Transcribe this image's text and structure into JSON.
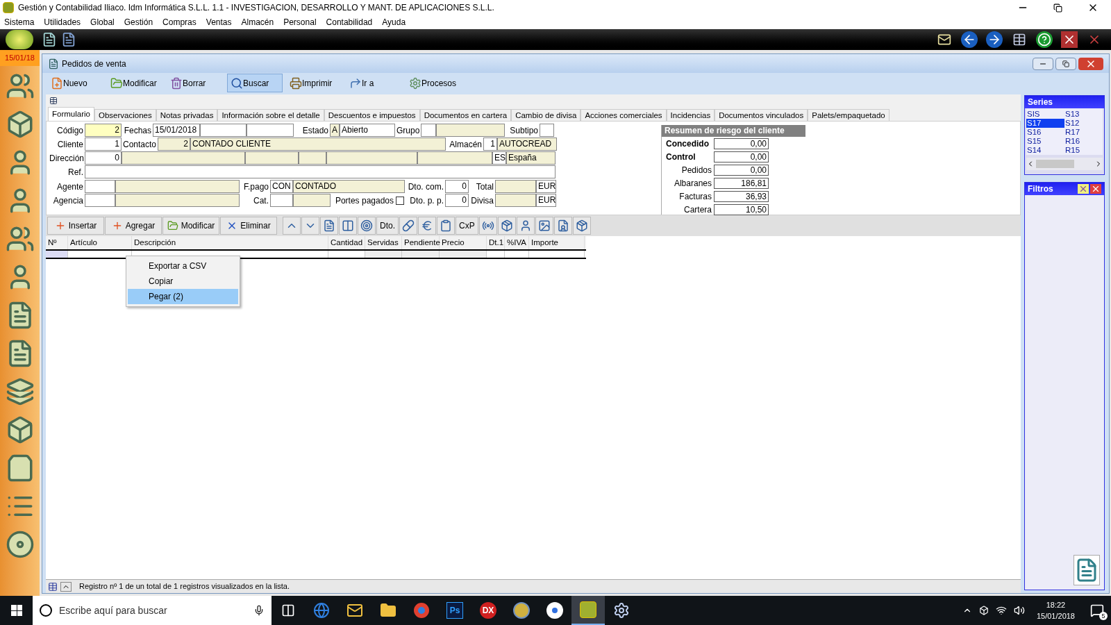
{
  "window": {
    "title": "Gestión y Contabilidad Iliaco. Idm Informática S.L.L. 1.1 - INVESTIGACION, DESARROLLO Y MANT. DE APLICACIONES S.L.L."
  },
  "menu": [
    "Sistema",
    "Utilidades",
    "Global",
    "Gestión",
    "Compras",
    "Ventas",
    "Almacén",
    "Personal",
    "Contabilidad",
    "Ayuda"
  ],
  "sidebar": {
    "date": "15/01/18"
  },
  "document": {
    "title": "Pedidos de venta",
    "toolbar": [
      {
        "label": "Nuevo",
        "selected": false
      },
      {
        "label": "Modificar",
        "selected": false
      },
      {
        "label": "Borrar",
        "selected": false
      },
      {
        "label": "Buscar",
        "selected": true
      },
      {
        "label": "Imprimir",
        "selected": false
      },
      {
        "label": "Ir a",
        "selected": false
      },
      {
        "label": "Procesos",
        "selected": false
      }
    ],
    "tabs": [
      {
        "label": "Formulario",
        "selected": true
      },
      {
        "label": "Observaciones",
        "selected": false
      },
      {
        "label": "Notas privadas",
        "selected": false
      },
      {
        "label": "Información sobre el detalle",
        "selected": false
      },
      {
        "label": "Descuentos e impuestos",
        "selected": false
      },
      {
        "label": "Documentos en cartera",
        "selected": false
      },
      {
        "label": "Cambio de divisa",
        "selected": false
      },
      {
        "label": "Acciones comerciales",
        "selected": false
      },
      {
        "label": "Incidencias",
        "selected": false
      },
      {
        "label": "Documentos vinculados",
        "selected": false
      },
      {
        "label": "Palets/empaquetado",
        "selected": false
      }
    ],
    "form": {
      "codigo": {
        "label": "Código",
        "value": "2"
      },
      "fechas": {
        "label": "Fechas",
        "value": "15/01/2018"
      },
      "estado": {
        "label": "Estado",
        "code": "A",
        "value": "Abierto"
      },
      "grupo": {
        "label": "Grupo"
      },
      "subtipo": {
        "label": "Subtipo"
      },
      "cliente": {
        "label": "Cliente",
        "value": "1"
      },
      "contacto": {
        "label": "Contacto",
        "code": "2",
        "value": "CONTADO CLIENTE"
      },
      "almacen": {
        "label": "Almacén",
        "code": "1",
        "value": "AUTOCREAD"
      },
      "direccion": {
        "label": "Dirección",
        "value": "0",
        "country_code": "ES",
        "country": "España"
      },
      "ref": {
        "label": "Ref."
      },
      "agente": {
        "label": "Agente"
      },
      "agencia": {
        "label": "Agencia"
      },
      "fpago": {
        "label": "F.pago",
        "code": "CON",
        "value": "CONTADO"
      },
      "cat": {
        "label": "Cat."
      },
      "portes": {
        "label": "Portes pagados",
        "checked": false
      },
      "dto_com": {
        "label": "Dto. com.",
        "value": "0"
      },
      "dto_pp": {
        "label": "Dto. p. p.",
        "value": "0"
      },
      "total": {
        "label": "Total",
        "currency": "EUR"
      },
      "divisa": {
        "label": "Divisa",
        "currency": "EUR"
      }
    },
    "risk": {
      "title": "Resumen de riesgo del cliente",
      "rows": [
        {
          "label": "Concedido",
          "value": "0,00",
          "bold": true
        },
        {
          "label": "Control",
          "value": "0,00",
          "bold": true
        },
        {
          "label": "Pedidos",
          "value": "0,00",
          "bold": false
        },
        {
          "label": "Albaranes",
          "value": "186,81",
          "bold": false
        },
        {
          "label": "Facturas",
          "value": "36,93",
          "bold": false
        },
        {
          "label": "Cartera",
          "value": "10,50",
          "bold": false
        }
      ]
    },
    "line_actions": [
      "Insertar",
      "Agregar",
      "Modificar",
      "Eliminar"
    ],
    "text_tools": [
      "Dto.",
      "CxP"
    ],
    "table": {
      "columns": [
        "Nº",
        "Artículo",
        "Descripción",
        "Cantidad",
        "Servidas",
        "Pendiente",
        "Precio",
        "Dt.1",
        "%IVA",
        "Importe"
      ]
    },
    "context_menu": [
      {
        "label": "Exportar a CSV",
        "selected": false
      },
      {
        "label": "Copiar",
        "selected": false
      },
      {
        "label": "Pegar (2)",
        "selected": true
      }
    ],
    "status": "Registro nº 1 de un total de 1 registros visualizados en la lista."
  },
  "series": {
    "title": "Series",
    "items": [
      {
        "label": "SIS",
        "selected": false
      },
      {
        "label": "S17",
        "selected": true
      },
      {
        "label": "S16",
        "selected": false
      },
      {
        "label": "S15",
        "selected": false
      },
      {
        "label": "S14",
        "selected": false
      },
      {
        "label": "S13",
        "selected": false
      },
      {
        "label": "S12",
        "selected": false
      },
      {
        "label": "R17",
        "selected": false
      },
      {
        "label": "R16",
        "selected": false
      },
      {
        "label": "R15",
        "selected": false
      }
    ]
  },
  "filters": {
    "title": "Filtros"
  },
  "taskbar": {
    "search_placeholder": "Escribe aquí para buscar",
    "app_labels": [
      "Ps",
      "DX"
    ],
    "time": "18:22",
    "date": "15/01/2018",
    "notifications": "5"
  }
}
